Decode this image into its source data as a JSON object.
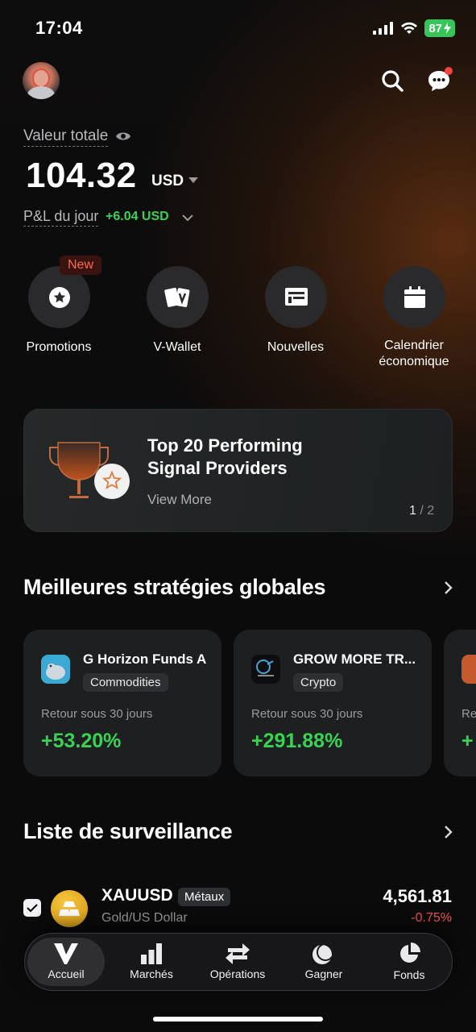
{
  "status_bar": {
    "time": "17:04",
    "battery": "87"
  },
  "header": {
    "avatar": "avatar",
    "search_icon": "search-icon",
    "chat_icon": "chat-icon"
  },
  "portfolio": {
    "total_label": "Valeur totale",
    "total_value": "104.32",
    "currency": "USD",
    "pnl_label": "P&L du jour",
    "pnl_value": "+6.04 USD"
  },
  "quick_actions": [
    {
      "label": "Promotions",
      "badge": "New",
      "icon": "star-icon"
    },
    {
      "label": "V-Wallet",
      "icon": "wallet-cards-icon"
    },
    {
      "label": "Nouvelles",
      "icon": "news-icon"
    },
    {
      "label": "Calendrier économique",
      "icon": "calendar-icon"
    }
  ],
  "banner": {
    "title": "Top 20 Performing Signal Providers",
    "link": "View More",
    "page_current": "1",
    "page_total": "/ 2"
  },
  "strategies": {
    "title": "Meilleures stratégies globales",
    "cards": [
      {
        "name": "G Horizon Funds A",
        "tag": "Commodities",
        "sub": "Retour sous 30 jours",
        "value": "+53.20%"
      },
      {
        "name": "GROW MORE TR...",
        "tag": "Crypto",
        "sub": "Retour sous 30 jours",
        "value": "+291.88%"
      },
      {
        "name": "",
        "tag": "",
        "sub": "Re",
        "value": "+"
      }
    ]
  },
  "watchlist": {
    "title": "Liste de surveillance",
    "items": [
      {
        "symbol": "XAUUSD",
        "tag": "Métaux",
        "desc": "Gold/US Dollar",
        "price": "4,561.81",
        "change": "-0.75%"
      }
    ]
  },
  "bottom_nav": [
    {
      "label": "Accueil",
      "active": true
    },
    {
      "label": "Marchés"
    },
    {
      "label": "Opérations"
    },
    {
      "label": "Gagner"
    },
    {
      "label": "Fonds"
    }
  ],
  "colors": {
    "positive": "#39d353",
    "negative": "#ff4d4f",
    "badge": "#ff6b45",
    "accent_glow": "#96461a"
  }
}
